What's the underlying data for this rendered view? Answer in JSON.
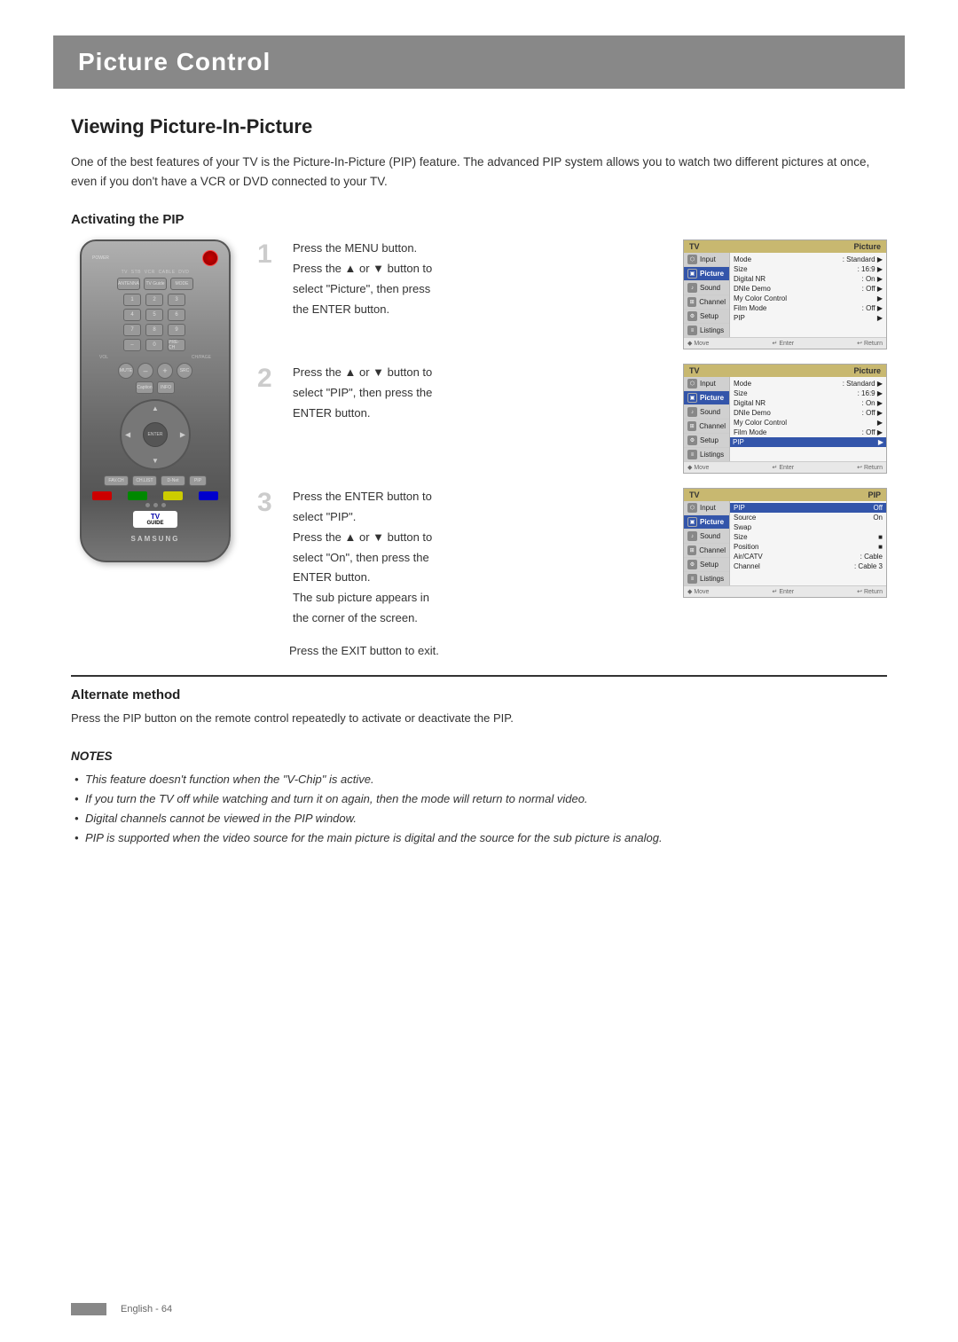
{
  "page": {
    "title": "Picture Control",
    "section": "Viewing Picture-In-Picture",
    "footer": "English - 64"
  },
  "intro": {
    "text": "One of the best features of your TV is the Picture-In-Picture (PIP) feature. The advanced PIP system allows you to watch two different pictures at once, even if you don't have a VCR or DVD connected to your TV."
  },
  "activating": {
    "heading": "Activating the PIP"
  },
  "steps": [
    {
      "number": "1",
      "lines": [
        "Press the MENU button.",
        "Press the ▲ or ▼ button to",
        "select \"Picture\", then press",
        "the ENTER button."
      ]
    },
    {
      "number": "2",
      "lines": [
        "Press the ▲ or ▼ button to",
        "select \"PIP\", then press the",
        "ENTER button."
      ]
    },
    {
      "number": "3",
      "lines": [
        "Press the ENTER button to",
        "select \"PIP\".",
        "Press the ▲ or ▼ button to",
        "select \"On\", then press the",
        "ENTER button.",
        "The sub picture appears in",
        "the corner of the screen."
      ]
    }
  ],
  "exit_text": "Press the EXIT button to exit.",
  "screen1": {
    "header_left": "TV",
    "header_right": "Picture",
    "menu_items": [
      {
        "label": "Input",
        "icon": "input"
      },
      {
        "label": "Picture",
        "icon": "picture",
        "active": true
      },
      {
        "label": "Sound",
        "icon": "sound"
      },
      {
        "label": "Channel",
        "icon": "channel"
      },
      {
        "label": "Setup",
        "icon": "setup"
      },
      {
        "label": "Listings",
        "icon": "listings"
      }
    ],
    "right_items": [
      {
        "name": "Mode",
        "value": ": Standard",
        "arrow": true
      },
      {
        "name": "Size",
        "value": ": 16:9",
        "arrow": true
      },
      {
        "name": "Digital NR",
        "value": ": On",
        "arrow": true
      },
      {
        "name": "DNIe Demo",
        "value": ": Off",
        "arrow": true
      },
      {
        "name": "My Color Control",
        "value": "",
        "arrow": true
      },
      {
        "name": "Film Mode",
        "value": ": Off",
        "arrow": true
      },
      {
        "name": "PIP",
        "value": "",
        "arrow": true
      }
    ],
    "footer": "◆ Move   ↵ Enter   ↩ Return"
  },
  "screen2": {
    "header_left": "TV",
    "header_right": "Picture",
    "right_items": [
      {
        "name": "Mode",
        "value": ": Standard",
        "arrow": true
      },
      {
        "name": "Size",
        "value": ": 16:9",
        "arrow": true
      },
      {
        "name": "Digital NR",
        "value": ": On",
        "arrow": true
      },
      {
        "name": "DNIe Demo",
        "value": ": Off",
        "arrow": true
      },
      {
        "name": "My Color Control",
        "value": "",
        "arrow": true
      },
      {
        "name": "Film Mode",
        "value": ": Off",
        "arrow": true
      },
      {
        "name": "PIP",
        "value": "",
        "arrow": true,
        "highlighted": true
      }
    ],
    "footer": "◆ Move   ↵ Enter   ↩ Return"
  },
  "screen3": {
    "header_left": "TV",
    "header_right": "PIP",
    "pip_items": [
      {
        "name": "PIP",
        "value": "Off",
        "highlighted": true
      },
      {
        "name": "Source",
        "value": "On"
      },
      {
        "name": "Swap",
        "value": ""
      },
      {
        "name": "Size",
        "value": "■"
      },
      {
        "name": "Position",
        "value": "■"
      },
      {
        "name": "Air/CATV",
        "value": ": Cable"
      },
      {
        "name": "Channel",
        "value": ": Cable 3"
      }
    ],
    "footer": "◆ Move   ↵ Enter   ↩ Return"
  },
  "alternate": {
    "heading": "Alternate method",
    "text": "Press the PIP button on the remote control repeatedly to activate or deactivate the PIP."
  },
  "notes": {
    "heading": "NOTES",
    "items": [
      "This feature doesn't function when the \"V-Chip\" is active.",
      "If you turn the TV off while watching and turn it on again, then the mode will return to normal video.",
      "Digital channels cannot be viewed in the PIP window.",
      "PIP is supported when the video source for the main picture is digital and the source for the sub picture is analog."
    ]
  },
  "remote": {
    "brand": "SAMSUNG",
    "tv_guide": "TV GUIDE"
  }
}
